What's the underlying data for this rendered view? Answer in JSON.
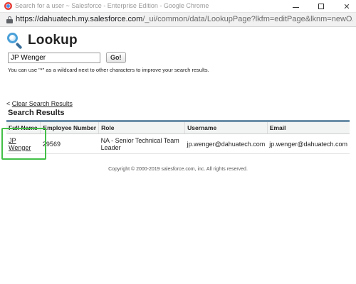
{
  "window": {
    "title": "Search for a user ~ Salesforce - Enterprise Edition - Google Chrome"
  },
  "address_bar": {
    "url_host": "https://dahuatech.my.salesforce.com",
    "url_path": "/_ui/common/data/LookupPage?lkfm=editPage&lknm=newO..."
  },
  "lookup": {
    "title": "Lookup",
    "search_value": "JP Wenger",
    "go_label": "Go!",
    "hint": "You can use \"*\" as a wildcard next to other characters to improve your search results."
  },
  "results": {
    "clear_prefix": "<",
    "clear_label": "Clear Search Results",
    "title": "Search Results",
    "columns": [
      "Full Name",
      "Employee Number",
      "Role",
      "Username",
      "Email"
    ],
    "rows": [
      {
        "full_name": "JP Wenger",
        "employee_number": "29569",
        "role": "NA - Senior Technical Team Leader",
        "username": "jp.wenger@dahuatech.com",
        "email": "jp.wenger@dahuatech.com"
      }
    ]
  },
  "footer": {
    "copyright": "Copyright © 2000-2019 salesforce.com, inc. All rights reserved."
  },
  "colors": {
    "highlight": "#43c047",
    "table_top_border": "#6d8fa9"
  }
}
